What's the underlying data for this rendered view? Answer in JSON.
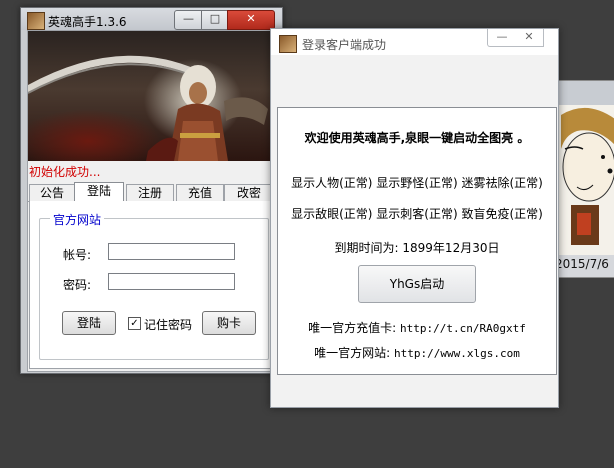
{
  "colors": {
    "desktop": "#3e3e3e",
    "status_red": "#d10000",
    "legend_blue": "#0000cc",
    "close_red": "#c0392b"
  },
  "background_window": {
    "date_text": "2015/7/6"
  },
  "login_window": {
    "title": "英魂高手1.3.6",
    "icon": "app-emblem-icon",
    "controls": {
      "minimize": "—",
      "maximize": "□",
      "close": "✕"
    },
    "status_text": "初始化成功...",
    "tabs": [
      {
        "label": "公告",
        "active": false
      },
      {
        "label": "登陆",
        "active": true
      },
      {
        "label": "注册",
        "active": false
      },
      {
        "label": "充值",
        "active": false
      },
      {
        "label": "改密",
        "active": false
      }
    ],
    "group_title": "官方网站",
    "account_label": "帐号:",
    "account_value": "",
    "password_label": "密码:",
    "password_value": "",
    "login_button": "登陆",
    "remember_checked": true,
    "remember_mark": "✓",
    "remember_label": "记住密码",
    "buy_card_button": "购卡"
  },
  "success_window": {
    "title": "登录客户端成功",
    "icon": "app-emblem-icon",
    "controls": {
      "minimize": "—",
      "maximize": "✕"
    },
    "welcome": "欢迎使用英魂高手,泉眼一键启动全图亮 。",
    "status_row_1": "显示人物(正常) 显示野怪(正常) 迷雾祛除(正常)",
    "status_row_2": "显示敌眼(正常) 显示刺客(正常) 致盲免疫(正常)",
    "expiry_label": "到期时间为:",
    "expiry_date": "1899年12月30日",
    "start_button": "YhGs启动",
    "recharge_label": "唯一官方充值卡:",
    "recharge_url": "http://t.cn/RA0gxtf",
    "website_label": "唯一官方网站:",
    "website_url": "http://www.xlgs.com"
  }
}
